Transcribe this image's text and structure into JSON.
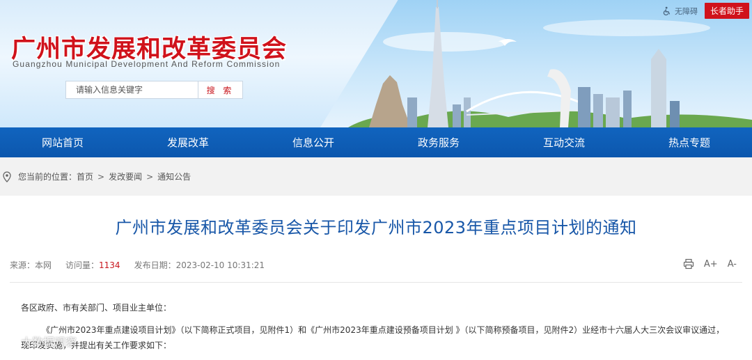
{
  "header": {
    "title": "广州市发展和改革委员会",
    "subtitle": "Guangzhou Municipal Development And Reform Commission",
    "accessibility_label": "无障碍",
    "elder_assist_label": "长者助手"
  },
  "search": {
    "placeholder": "请输入信息关键字",
    "button_label": "搜 索"
  },
  "nav": {
    "items": [
      "网站首页",
      "发展改革",
      "信息公开",
      "政务服务",
      "互动交流",
      "热点专题"
    ]
  },
  "breadcrumb": {
    "prefix": "您当前的位置：",
    "items": [
      "首页",
      "发改要闻",
      "通知公告"
    ],
    "separator": ">"
  },
  "article": {
    "title": "广州市发展和改革委员会关于印发广州市2023年重点项目计划的通知",
    "source_label": "来源：本网",
    "visits_label": "访问量：",
    "visits_value": "1134",
    "date_label": "发布日期：2023-02-10 10:31:21",
    "tools": {
      "print": "print-icon",
      "font_larger": "A+",
      "font_smaller": "A-"
    },
    "paragraphs": [
      "各区政府、市有关部门、项目业主单位：",
      "《广州市2023年重点建设项目计划》（以下简称正式项目，见附件1）和《广州市2023年重点建设预备项目计划 》（以下简称预备项目，见附件2）业经市十六届人大三次会议审议通过，现印发实施，并提出有关工作要求如下："
    ]
  },
  "watermark": {
    "text": "大数据观察"
  },
  "colors": {
    "brand_red": "#d0121b",
    "nav_blue": "#0c57ad",
    "title_blue": "#1857a8"
  }
}
